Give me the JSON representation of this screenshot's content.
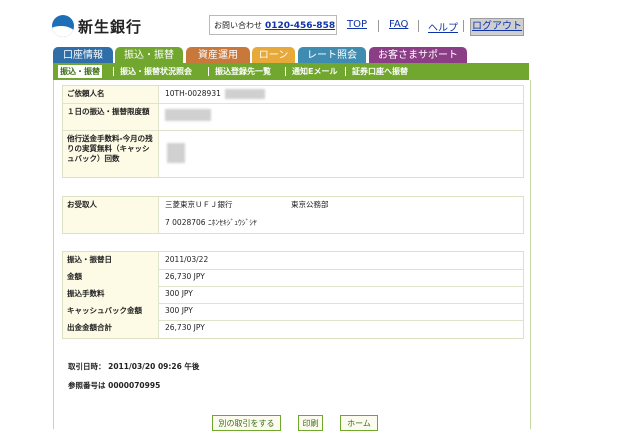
{
  "header": {
    "bank_name": "新生銀行",
    "contact_label": "お問い合わせ",
    "contact_phone": "0120-456-858",
    "links": [
      "TOP",
      "FAQ",
      "ヘルプ"
    ],
    "logout_label": "ログアウト"
  },
  "tabs": [
    {
      "label": "口座情報",
      "color": "#2f6ea8"
    },
    {
      "label": "振込・振替",
      "color": "#71a72e"
    },
    {
      "label": "資産運用",
      "color": "#c9783c"
    },
    {
      "label": "ローン",
      "color": "#e6a93a"
    },
    {
      "label": "レート照会",
      "color": "#3f8cb0"
    },
    {
      "label": "お客さまサポート",
      "color": "#8b3d86"
    }
  ],
  "subnav": [
    "振込・振替",
    "振込・振替状況照会",
    "振込登録先一覧",
    "通知Eメール",
    "証券口座へ振替"
  ],
  "section1": {
    "rows": [
      {
        "label": "ご依頼人名",
        "value": "10TH-0028931"
      },
      {
        "label": "１日の振込・振替限度額",
        "value": ""
      },
      {
        "label": "他行送金手数料-今月の残りの実質無料（キャッシュバック）回数",
        "value": ""
      }
    ]
  },
  "section2": {
    "rows": [
      {
        "label": "お受取人",
        "bank": "三菱東京ＵＦＪ銀行",
        "branch": "東京公務部",
        "account": "7 0028706 ﾆﾎﾝｾｷｼﾞｭｳｼﾞｼﾔ"
      }
    ]
  },
  "section3": {
    "rows": [
      {
        "label": "振込・振替日",
        "value": "2011/03/22"
      },
      {
        "label": "金額",
        "value": "26,730 JPY"
      },
      {
        "label": "振込手数料",
        "value": "300 JPY"
      },
      {
        "label": "キャッシュバック金額",
        "value": "300 JPY"
      },
      {
        "label": "出金金額合計",
        "value": "26,730 JPY"
      }
    ]
  },
  "footer": {
    "datetime": "取引日時： 2011/03/20 09:26 午後",
    "reference": "参照番号は 0000070995"
  },
  "buttons": [
    "別の取引をする",
    "印刷",
    "ホーム"
  ]
}
